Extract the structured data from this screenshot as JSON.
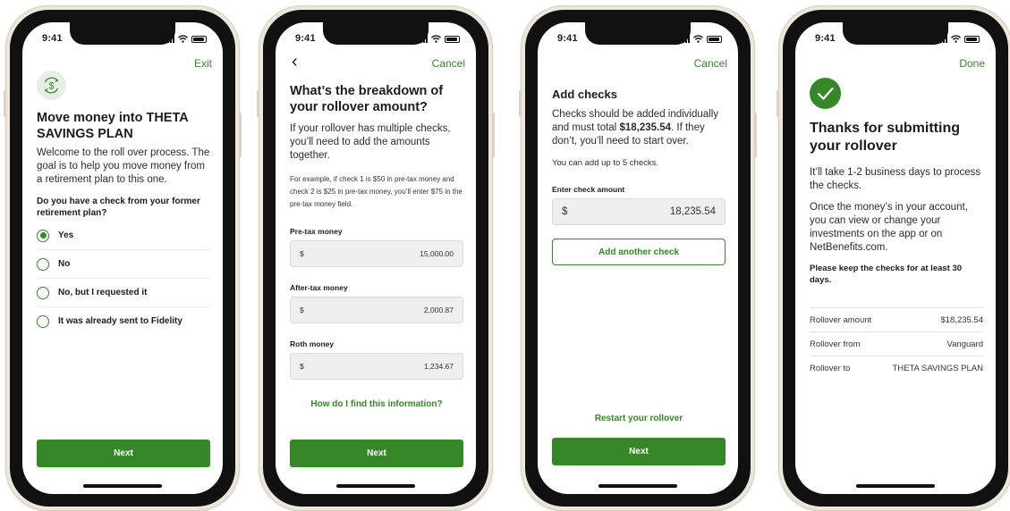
{
  "status_time": "9:41",
  "screens": {
    "s1": {
      "top_action": "Exit",
      "title": "Move money into THETA SAVINGS PLAN",
      "intro": "Welcome to the roll over process. The goal is to help you move money from a retirement plan to this one.",
      "question": "Do you have a check from your former retirement plan?",
      "options": [
        "Yes",
        "No",
        "No, but I requested it",
        "It was already sent to Fidelity"
      ],
      "selected_option": "Yes",
      "next": "Next"
    },
    "s2": {
      "top_action": "Cancel",
      "back_glyph": "‹",
      "title": "What’s the breakdown of your rollover amount?",
      "intro": "If your rollover has multiple checks, you’ll need to add the amounts together.",
      "example": "For example, if check 1 is $50 in pre-tax money and check 2 is $25 in pre-tax money, you’ll enter $75 in the pre-tax money field.",
      "fields": [
        {
          "label": "Pre-tax money",
          "currency": "$",
          "value": "15,000.00"
        },
        {
          "label": "After-tax money",
          "currency": "$",
          "value": "2,000.87"
        },
        {
          "label": "Roth money",
          "currency": "$",
          "value": "1,234.67"
        }
      ],
      "help_link": "How do I find this information?",
      "next": "Next"
    },
    "s3": {
      "top_action": "Cancel",
      "title": "Add checks",
      "intro_part1": "Checks should be added individually and must total ",
      "intro_total": "$18,235.54",
      "intro_part2": ". If they don’t, you’ll need to start over.",
      "limit_note": "You can add up to 5 checks.",
      "field_label": "Enter check amount",
      "field_currency": "$",
      "field_value": "18,235.54",
      "add_button": "Add another check",
      "restart_link": "Restart your rollover",
      "next": "Next"
    },
    "s4": {
      "top_action": "Done",
      "title": "Thanks for submitting your rollover",
      "para1": "It’ll take 1-2 business days to process the checks.",
      "para2": "Once the money’s in your account, you can view or change your investments on the app or on NetBenefits.com.",
      "keep_note": "Please keep the checks for at least 30 days.",
      "summary": [
        {
          "label": "Rollover amount",
          "value": "$18,235.54"
        },
        {
          "label": "Rollover from",
          "value": "Vanguard"
        },
        {
          "label": "Rollover to",
          "value": "THETA SAVINGS PLAN"
        }
      ]
    }
  },
  "colors": {
    "accent": "#368727",
    "frame": "#ece6db"
  },
  "icons": {
    "dollar_cycle": "dollar-cycle-icon",
    "success": "checkmark-circle-icon",
    "back": "chevron-left-icon"
  }
}
